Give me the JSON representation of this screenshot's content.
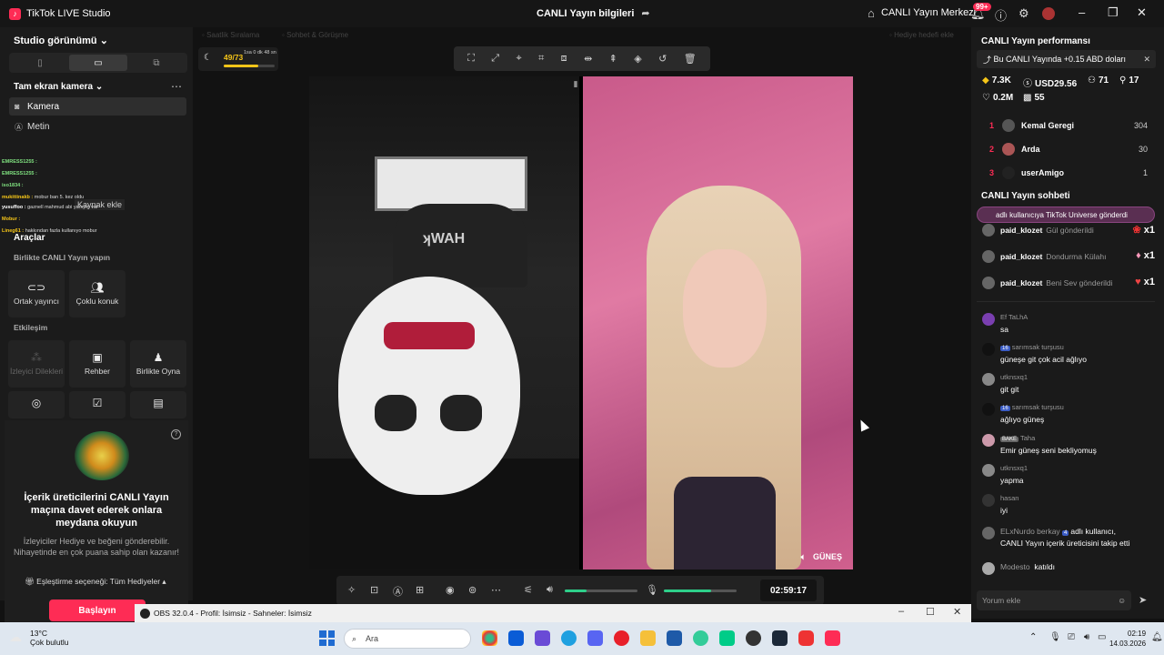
{
  "app": {
    "title": "TikTok LIVE Studio",
    "center_title": "CANLI Yayın bilgileri",
    "center_right": "CANLI Yayın Merkezi",
    "notif_badge": "99+"
  },
  "left": {
    "view_title": "Studio görünümü",
    "source_heading": "Tam ekran kamera",
    "sources": [
      {
        "label": "Kamera"
      },
      {
        "label": "Metin"
      }
    ],
    "add_source": "Kaynak ekle",
    "chat_overlay": [
      {
        "name": "EMRESS1255 :"
      },
      {
        "name": "EMRESS1255 :"
      },
      {
        "name": "iso1834 :"
      },
      {
        "name": "mukittinakb :",
        "text": "mobur ban 5. kez oldu"
      },
      {
        "name": "yusuffoo :",
        "text": "gaznell mahmud abi yanıyın var"
      },
      {
        "name": "Mobur :"
      },
      {
        "name": "Lineg61 :",
        "text": "hakkından fazla kullanıyo mobur"
      }
    ],
    "tools_title": "Araçlar",
    "section_together": "Birlikte CANLI Yayın yapın",
    "tools_together": [
      {
        "label": "Ortak yayıncı"
      },
      {
        "label": "Çoklu konuk"
      }
    ],
    "section_interaction": "Etkileşim",
    "tools_interaction": [
      {
        "label": "İzleyici Dilekleri"
      },
      {
        "label": "Rehber"
      },
      {
        "label": "Birlikte Oyna"
      }
    ],
    "invite_title": "İçerik üreticilerini CANLI Yayın maçına davet ederek onlara meydana okuyun",
    "invite_desc": "İzleyiciler Hediye ve beğeni gönderebilir. Nihayetinde en çok puana sahip olan kazanır!",
    "match_option": "Eşleştirme seçeneği: Tüm Hediyeler",
    "start_button": "Başlayın"
  },
  "center": {
    "faint_left": "Saatlik Sıralama",
    "faint_mid": "Sohbet & Görüşme",
    "faint_right": "Hediye hedefi ekle",
    "progress": "49/73",
    "progress_fraction": 0.67,
    "progress_time": "1sa 0 dk 48 sn",
    "guest_name": "GÜNEŞ",
    "timer": "02:59:17",
    "volume_level": 0.3,
    "mic_level": 0.65
  },
  "right": {
    "perf_title": "CANLI Yayın performansı",
    "earn_text": "Bu CANLI Yayında +0.15 ABD doları",
    "metrics": [
      {
        "icon": "diamond-icon",
        "value": "7.3K"
      },
      {
        "icon": "coin-icon",
        "value": "USD29.56"
      },
      {
        "icon": "viewers-icon",
        "value": "71"
      },
      {
        "icon": "followers-icon",
        "value": "17"
      },
      {
        "icon": "heart-icon",
        "value": "0.2M"
      },
      {
        "icon": "gift-box-icon",
        "value": "55"
      }
    ],
    "ranking": [
      {
        "rank": "1",
        "name": "Kemal Geregi",
        "score": "304"
      },
      {
        "rank": "2",
        "name": "Arda",
        "score": "30"
      },
      {
        "rank": "3",
        "name": "userAmigo",
        "score": "1"
      }
    ],
    "chat_title": "CANLI Yayın sohbeti",
    "gift_banner": "adlı kullanıcıya TikTok Universe gönderdi",
    "gift_rows": [
      {
        "name": "paid_klozet",
        "text": "Gül gönderildi",
        "count": "x1"
      },
      {
        "name": "paid_klozet",
        "text": "Dondurma Külahı",
        "count": "x1"
      },
      {
        "name": "paid_klozet",
        "text": "Beni Sev gönderildi",
        "count": "x1"
      }
    ],
    "comments": [
      {
        "user": "Ef TaLhA",
        "badge": "",
        "text": "sa"
      },
      {
        "user": "sarımsak turşusu",
        "badge": "16",
        "text": "güneşe git çok acil ağlıyo"
      },
      {
        "user": "utknsxq1",
        "badge": "",
        "text": "git git"
      },
      {
        "user": "sarımsak turşusu",
        "badge": "16",
        "text": "ağlıyo güneş"
      },
      {
        "user": "Taha",
        "badge": "BAKE",
        "text": "Emir güneş seni bekliyomuş"
      },
      {
        "user": "utknsxq1",
        "badge": "",
        "text": "yapma"
      },
      {
        "user": "hasan",
        "badge": "",
        "text": "iyi"
      }
    ],
    "follow_user": "ELxNurdo berkay",
    "follow_badge": "4",
    "follow_text": "adlı kullanıcı,",
    "follow_text2": "CANLI Yayın içerik üreticisini takip etti",
    "joined_user": "Modesto",
    "joined_text": "katıldı",
    "comment_placeholder": "Yorum ekle"
  },
  "obs": {
    "title": "OBS 32.0.4 - Profil: İsimsiz - Sahneler: İsimsiz"
  },
  "taskbar": {
    "temp": "13°C",
    "weather": "Çok bulutlu",
    "search": "Ara",
    "time": "02:19",
    "date": "14.03.2026"
  }
}
